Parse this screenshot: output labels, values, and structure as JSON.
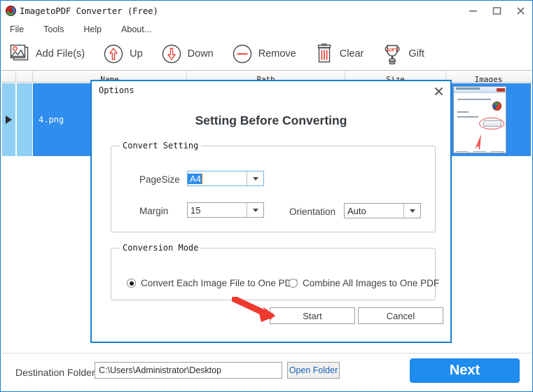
{
  "window": {
    "title": "ImagetoPDF Converter (Free)",
    "icon": "app-logo-icon",
    "controls": [
      {
        "name": "minimize",
        "glyph": "minimize-icon"
      },
      {
        "name": "maximize",
        "glyph": "maximize-icon"
      },
      {
        "name": "close",
        "glyph": "close-icon"
      }
    ]
  },
  "menu": {
    "items": [
      {
        "label": "File"
      },
      {
        "label": "Tools"
      },
      {
        "label": "Help"
      },
      {
        "label": "About..."
      }
    ]
  },
  "toolbar": {
    "buttons": [
      {
        "label": "Add File(s)",
        "icon": "image-stack-icon"
      },
      {
        "label": "Up",
        "icon": "arrow-up-circle-icon"
      },
      {
        "label": "Down",
        "icon": "arrow-down-circle-icon"
      },
      {
        "label": "Remove",
        "icon": "minus-circle-icon"
      },
      {
        "label": "Clear",
        "icon": "trash-icon"
      },
      {
        "label": "Gift",
        "icon": "gift-trophy-icon"
      }
    ]
  },
  "file_list": {
    "columns": [
      "Name",
      "Path",
      "Size",
      "Images"
    ],
    "rows": [
      {
        "selected": true,
        "name": "4.png",
        "path": "",
        "size": "",
        "thumbnail": "wizard-screenshot-thumbnail"
      }
    ]
  },
  "dialog": {
    "title": "Options",
    "heading": "Setting Before Converting",
    "close_icon": "close-icon",
    "convert_setting": {
      "legend": "Convert Setting",
      "page_size": {
        "label": "PageSize",
        "value": "A4",
        "selected": true
      },
      "margin": {
        "label": "Margin",
        "value": "15"
      },
      "orientation": {
        "label": "Orientation",
        "value": "Auto"
      }
    },
    "conversion_mode": {
      "legend": "Conversion Mode",
      "options": [
        {
          "label": "Convert Each Image File to One PDF",
          "checked": true
        },
        {
          "label": "Combine All Images to One PDF",
          "checked": false
        }
      ]
    },
    "buttons": {
      "start": "Start",
      "cancel": "Cancel"
    }
  },
  "bottom_bar": {
    "destination_label": "Destination Folder:",
    "destination_value": "C:\\Users\\Administrator\\Desktop",
    "destination_placeholder": "",
    "open_folder_label": "Open Folder",
    "next_label": "Next"
  },
  "annotation": {
    "arrow": "red-pointer-arrow",
    "color": "#ee3b2f"
  },
  "colors": {
    "accent_blue": "#1f8cf0",
    "window_border": "#1a7fd4",
    "row_selected": "#2e8ded",
    "row_indicator": "#8fd0f4",
    "icon_red": "#e8443a",
    "link_blue": "#1a5fb4"
  }
}
